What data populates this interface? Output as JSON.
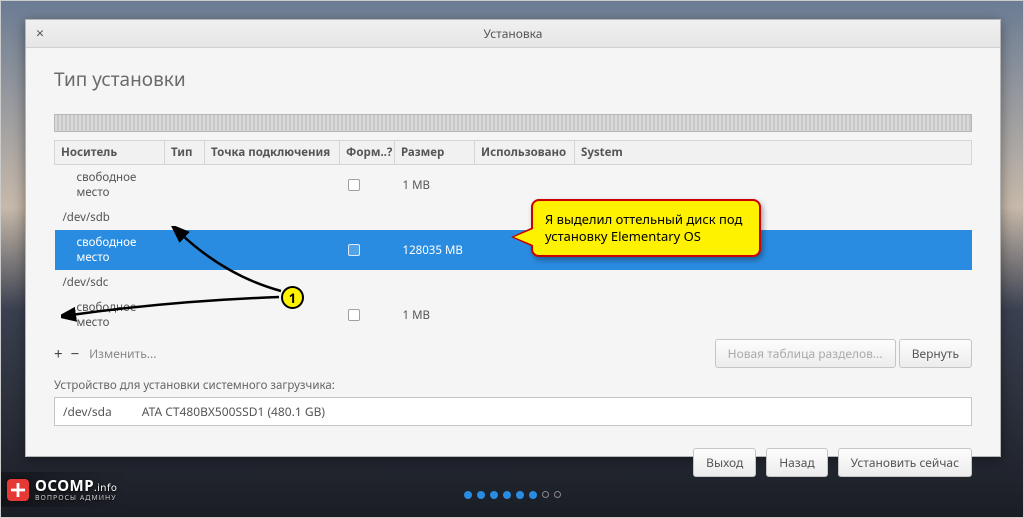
{
  "window": {
    "title": "Установка",
    "close": "×"
  },
  "page_title": "Тип установки",
  "columns": {
    "device": "Носитель",
    "type": "Тип",
    "mount": "Точка подключения",
    "format": "Форм..?",
    "size": "Размер",
    "used": "Использовано",
    "system": "System"
  },
  "rows": [
    {
      "device": "свободное место",
      "indent": true,
      "size": "1 MB",
      "selected": false,
      "checkbox": true
    },
    {
      "device": "/dev/sdb",
      "indent": false,
      "size": "",
      "selected": false,
      "checkbox": false
    },
    {
      "device": "свободное место",
      "indent": true,
      "size": "128035 MB",
      "selected": true,
      "checkbox": true
    },
    {
      "device": "/dev/sdc",
      "indent": false,
      "size": "",
      "selected": false,
      "checkbox": false
    },
    {
      "device": "свободное место",
      "indent": true,
      "size": "1 MB",
      "selected": false,
      "checkbox": true
    }
  ],
  "toolbar": {
    "plusminus": "+  −",
    "change": "Изменить...",
    "new_table": "Новая таблица разделов...",
    "revert": "Вернуть"
  },
  "bootloader": {
    "label": "Устройство для установки системного загрузчика:",
    "device": "/dev/sda",
    "desc": "ATA CT480BX500SSD1 (480.1 GB)"
  },
  "buttons": {
    "quit": "Выход",
    "back": "Назад",
    "install": "Установить сейчас"
  },
  "callout": {
    "text": "Я выделил оттельный диск под установку Elementary OS"
  },
  "badge": {
    "num": "1"
  },
  "logo": {
    "brand": "OCOMP",
    "suffix": ".info",
    "sub": "ВОПРОСЫ АДМИНУ"
  }
}
